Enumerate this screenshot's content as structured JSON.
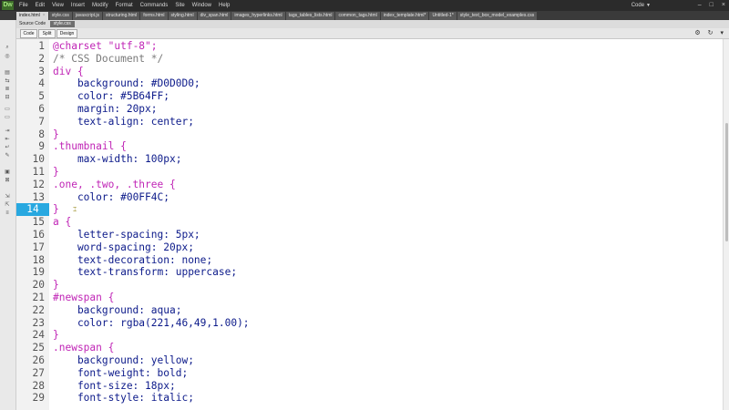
{
  "app": {
    "logo": "Dw",
    "menu": [
      "File",
      "Edit",
      "View",
      "Insert",
      "Modify",
      "Format",
      "Commands",
      "Site",
      "Window",
      "Help"
    ],
    "workspace": "Code",
    "window_controls": [
      "–",
      "□",
      "×"
    ]
  },
  "tabs": [
    {
      "label": "index.html",
      "active": true
    },
    {
      "label": "style.css",
      "active": false
    },
    {
      "label": "javascript.js",
      "active": false
    },
    {
      "label": "structuring.html",
      "active": false
    },
    {
      "label": "forms.html",
      "active": false
    },
    {
      "label": "styling.html",
      "active": false
    },
    {
      "label": "div_span.html",
      "active": false
    },
    {
      "label": "images_hyperlinks.html",
      "active": false
    },
    {
      "label": "tags_tables_lists.html",
      "active": false
    },
    {
      "label": "common_tags.html",
      "active": false
    },
    {
      "label": "index_template.html*",
      "active": false
    },
    {
      "label": "Untitled-1*",
      "active": false
    },
    {
      "label": "style_text_box_model_examples.css",
      "active": false
    }
  ],
  "source_bar": {
    "label": "Source Code",
    "file": "style.css"
  },
  "view_buttons": {
    "code": "Code",
    "split": "Split",
    "design": "Design"
  },
  "editor": {
    "active_line": 14,
    "lines": [
      {
        "n": "1",
        "parts": [
          [
            "c-at",
            "@charset "
          ],
          [
            "c-str",
            "\"utf-8\""
          ],
          [
            "c-at",
            ";"
          ]
        ]
      },
      {
        "n": "2",
        "parts": [
          [
            "c-com",
            "/* CSS Document */"
          ]
        ]
      },
      {
        "n": "3",
        "parts": [
          [
            "c-sel",
            "div {"
          ]
        ]
      },
      {
        "n": "4",
        "parts": [
          [
            "c-prop",
            "    background: "
          ],
          [
            "c-val",
            "#D0D0D0;"
          ]
        ]
      },
      {
        "n": "5",
        "parts": [
          [
            "c-prop",
            "    color: "
          ],
          [
            "c-val",
            "#5B64FF;"
          ]
        ]
      },
      {
        "n": "6",
        "parts": [
          [
            "c-prop",
            "    margin: "
          ],
          [
            "c-val",
            "20px;"
          ]
        ]
      },
      {
        "n": "7",
        "parts": [
          [
            "c-prop",
            "    text-align: "
          ],
          [
            "c-val",
            "center;"
          ]
        ]
      },
      {
        "n": "8",
        "parts": [
          [
            "c-br",
            "}"
          ]
        ]
      },
      {
        "n": "9",
        "parts": [
          [
            "c-sel",
            ".thumbnail {"
          ]
        ]
      },
      {
        "n": "10",
        "parts": [
          [
            "c-prop",
            "    max-width: "
          ],
          [
            "c-val",
            "100px;"
          ]
        ]
      },
      {
        "n": "11",
        "parts": [
          [
            "c-br",
            "}"
          ]
        ]
      },
      {
        "n": "12",
        "parts": [
          [
            "c-sel",
            ".one, .two, .three {"
          ]
        ]
      },
      {
        "n": "13",
        "parts": [
          [
            "c-prop",
            "    color: "
          ],
          [
            "c-val",
            "#00FF4C;"
          ]
        ]
      },
      {
        "n": "14",
        "parts": [
          [
            "c-br",
            "}"
          ]
        ]
      },
      {
        "n": "15",
        "parts": [
          [
            "c-sel",
            "a {"
          ]
        ]
      },
      {
        "n": "16",
        "parts": [
          [
            "c-prop",
            "    letter-spacing: "
          ],
          [
            "c-val",
            "5px;"
          ]
        ]
      },
      {
        "n": "17",
        "parts": [
          [
            "c-prop",
            "    word-spacing: "
          ],
          [
            "c-val",
            "20px;"
          ]
        ]
      },
      {
        "n": "18",
        "parts": [
          [
            "c-prop",
            "    text-decoration: "
          ],
          [
            "c-val",
            "none;"
          ]
        ]
      },
      {
        "n": "19",
        "parts": [
          [
            "c-prop",
            "    text-transform: "
          ],
          [
            "c-val",
            "uppercase;"
          ]
        ]
      },
      {
        "n": "20",
        "parts": [
          [
            "c-br",
            "}"
          ]
        ]
      },
      {
        "n": "21",
        "parts": [
          [
            "c-sel",
            "#newspan {"
          ]
        ]
      },
      {
        "n": "22",
        "parts": [
          [
            "c-prop",
            "    background: "
          ],
          [
            "c-val",
            "aqua;"
          ]
        ]
      },
      {
        "n": "23",
        "parts": [
          [
            "c-prop",
            "    color: "
          ],
          [
            "c-val",
            "rgba(221,46,49,1.00);"
          ]
        ]
      },
      {
        "n": "24",
        "parts": [
          [
            "c-br",
            "}"
          ]
        ]
      },
      {
        "n": "25",
        "parts": [
          [
            "c-sel",
            ".newspan {"
          ]
        ]
      },
      {
        "n": "26",
        "parts": [
          [
            "c-prop",
            "    background: "
          ],
          [
            "c-val",
            "yellow;"
          ]
        ]
      },
      {
        "n": "27",
        "parts": [
          [
            "c-prop",
            "    font-weight: "
          ],
          [
            "c-val",
            "bold;"
          ]
        ]
      },
      {
        "n": "28",
        "parts": [
          [
            "c-prop",
            "    font-size: "
          ],
          [
            "c-val",
            "18px;"
          ]
        ]
      },
      {
        "n": "29",
        "parts": [
          [
            "c-prop",
            "    font-style: "
          ],
          [
            "c-val",
            "italic;"
          ]
        ]
      }
    ]
  },
  "colors": {
    "accent": "#28a8e0",
    "selector": "#c025b6",
    "property": "#0c1a8a",
    "comment": "#7a7a7a"
  },
  "icons": {
    "tools": [
      "inspect-icon",
      "live-view-icon",
      "split-icon",
      "code-nav-icon",
      "format-icon",
      "comment-icon",
      "indent-icon",
      "outdent-icon",
      "wrap-icon",
      "highlight-icon",
      "snippet-icon",
      "apply-icon",
      "remove-icon",
      "move-icon",
      "expand-icon",
      "collapse-icon",
      "indent2-icon"
    ],
    "right": [
      "settings-icon",
      "refresh-icon",
      "filter-icon"
    ]
  }
}
